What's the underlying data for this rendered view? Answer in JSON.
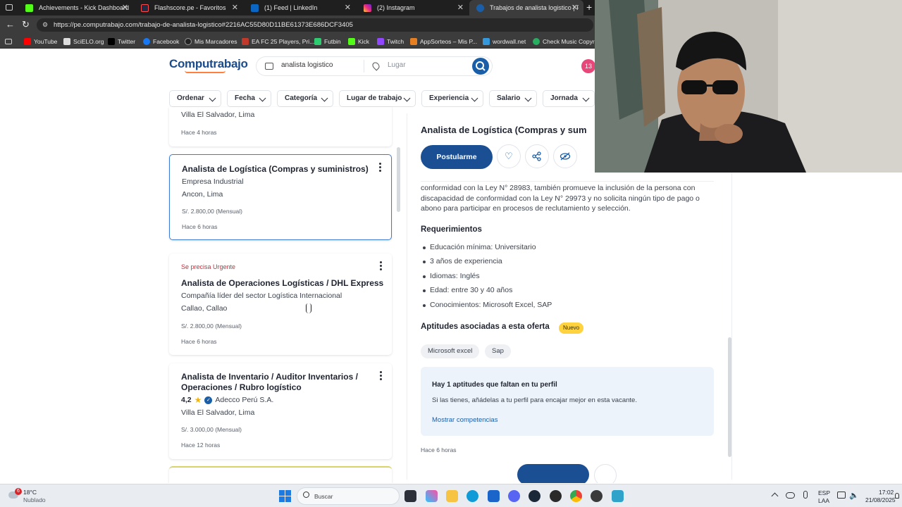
{
  "browser": {
    "tabs": [
      {
        "label": "Achievements - Kick Dashboard",
        "color": "#53fc18"
      },
      {
        "label": "Flashscore.pe - Favoritos",
        "color": "#1f2a44"
      },
      {
        "label": "(1) Feed | LinkedIn",
        "color": "#0a66c2"
      },
      {
        "label": "(2) Instagram",
        "color": "#e1306c"
      },
      {
        "label": "Trabajos de analista logistico | Po",
        "color": "#1b5ea8"
      }
    ],
    "url": "https://pe.computrabajo.com/trabajo-de-analista-logistico#2216AC55D80D11BE61373E686DCF3405",
    "bookmarks": [
      {
        "label": "YouTube",
        "color": "#ff0000"
      },
      {
        "label": "SciELO.org",
        "color": "#dddddd"
      },
      {
        "label": "Twitter",
        "color": "#000000"
      },
      {
        "label": "Facebook",
        "color": "#1877f2"
      },
      {
        "label": "Mis Marcadores",
        "color": "#222222"
      },
      {
        "label": "EA FC 25 Players, Pri...",
        "color": "#c0392b"
      },
      {
        "label": "Futbin",
        "color": "#2ecc71"
      },
      {
        "label": "Kick",
        "color": "#53fc18"
      },
      {
        "label": "Twitch",
        "color": "#9146ff"
      },
      {
        "label": "AppSorteos – Mis P...",
        "color": "#e67e22"
      },
      {
        "label": "wordwall.net",
        "color": "#3498db"
      },
      {
        "label": "Check Music Copyri...",
        "color": "#27ae60"
      }
    ]
  },
  "header": {
    "logo": "Computrabajo",
    "search_query": "analista logistico",
    "location_placeholder": "Lugar",
    "notifications": "13"
  },
  "filters": [
    "Ordenar",
    "Fecha",
    "Categoría",
    "Lugar de trabajo",
    "Experiencia",
    "Salario",
    "Jornada"
  ],
  "results": {
    "partial_card": {
      "location": "Villa El Salvador, Lima",
      "time": "Hace 4 horas"
    },
    "cards": [
      {
        "title": "Analista de Logística (Compras y suministros)",
        "company": "Empresa Industrial",
        "location": "Ancon, Lima",
        "salary": "S/. 2.800,00 (Mensual)",
        "time": "Hace 6 horas"
      },
      {
        "urgent": "Se precisa Urgente",
        "title": "Analista de Operaciones Logísticas / DHL Express",
        "company": "Compañía líder del sector Logística Internacional",
        "location": "Callao, Callao",
        "salary": "S/. 2.800,00 (Mensual)",
        "time": "Hace 6 horas"
      },
      {
        "title_line1": "Analista de Inventario / Auditor Inventarios /",
        "title_line2": "Operaciones / Rubro logístico",
        "rating": "4,2",
        "company": "Adecco Perú S.A.",
        "location": "Villa El Salvador, Lima",
        "salary": "S/. 3.000,00 (Mensual)",
        "time": "Hace 12 horas"
      }
    ]
  },
  "detail": {
    "title": "Analista de Logística (Compras y sum",
    "apply": "Postularme",
    "paragraph": "conformidad con la Ley N° 28983, también promueve la inclusión de la persona con discapacidad de conformidad con la Ley N° 29973 y no solicita ningún tipo de pago o abono para participar en procesos de reclutamiento y selección.",
    "req_heading": "Requerimientos",
    "requirements": [
      "Educación mínima: Universitario",
      "3 años de experiencia",
      "Idiomas: Inglés",
      "Edad: entre 30 y 40 años",
      "Conocimientos: Microsoft Excel, SAP"
    ],
    "skills_heading": "Aptitudes asociadas a esta oferta",
    "new_badge": "Nuevo",
    "skills": [
      "Microsoft excel",
      "Sap"
    ],
    "missing_title": "Hay 1 aptitudes que faltan en tu perfil",
    "missing_text": "Si las tienes, añádelas a tu perfil para encajar mejor en esta vacante.",
    "missing_link": "Mostrar competencias",
    "time": "Hace 6 horas"
  },
  "taskbar": {
    "weather_temp": "18°C",
    "weather_desc": "Nublado",
    "weather_badge": "6",
    "search": "Buscar",
    "lang1": "ESP",
    "lang2": "LAA",
    "time": "17:02",
    "date": "21/08/2025"
  }
}
